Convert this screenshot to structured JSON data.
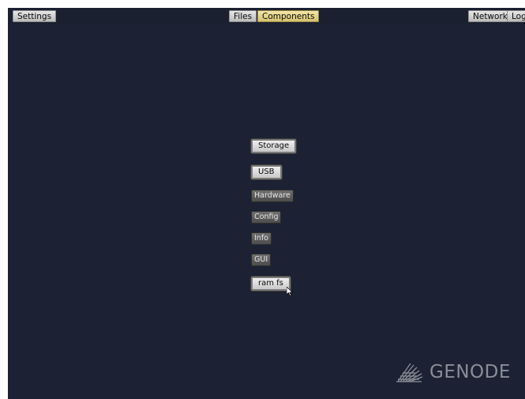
{
  "topbar": {
    "settings": "Settings",
    "files": "Files",
    "components": "Components",
    "network": "Network",
    "log": "Log"
  },
  "menu": {
    "items": [
      {
        "label": "Storage"
      },
      {
        "label": "USB"
      },
      {
        "label": "Hardware"
      },
      {
        "label": "Config"
      },
      {
        "label": "Info"
      },
      {
        "label": "GUI"
      },
      {
        "label": "ram fs"
      }
    ]
  },
  "logo": {
    "text": "GENODE"
  },
  "colors": {
    "desktop": "#1c2233",
    "selected_tab": "#e6d890",
    "button_dark": "#5a5a5a",
    "button_light": "#dcdcdc",
    "logo": "#8a8e98"
  }
}
